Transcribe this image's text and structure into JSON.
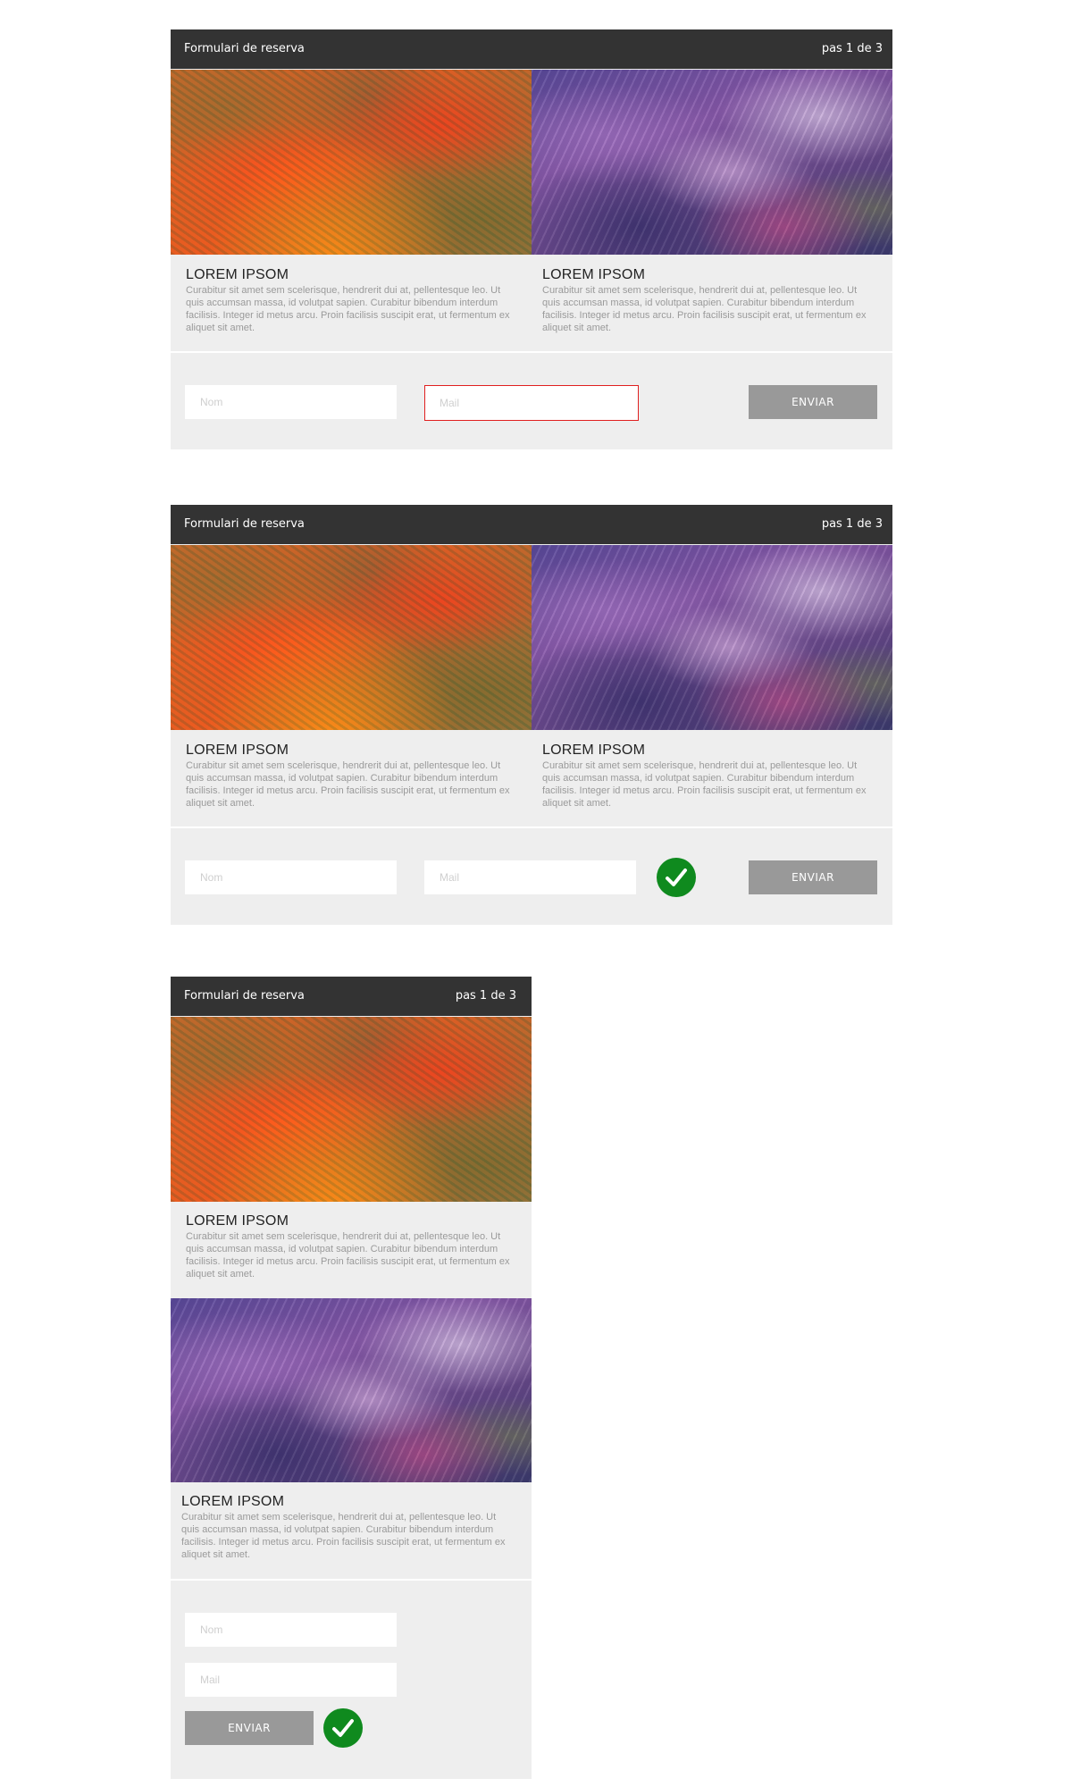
{
  "header": {
    "title": "Formulari de reserva",
    "step": "pas 1 de 3"
  },
  "card1": {
    "title": "LOREM IPSOM",
    "text": "Curabitur sit amet sem scelerisque, hendrerit dui at, pellentesque leo. Ut quis accumsan massa, id volutpat sapien. Curabitur bibendum interdum facilisis. Integer id metus arcu. Proin facilisis suscipit erat, ut fermentum ex aliquet sit amet."
  },
  "card2": {
    "title": "LOREM IPSOM",
    "text": "Curabitur sit amet sem scelerisque, hendrerit dui at, pellentesque leo. Ut quis accumsan massa, id volutpat sapien. Curabitur bibendum interdum facilisis. Integer id metus arcu. Proin facilisis suscipit erat, ut fermentum ex aliquet sit amet."
  },
  "form": {
    "name_placeholder": "Nom",
    "mail_placeholder": "Mail",
    "submit_label": "ENVIAR"
  },
  "colors": {
    "header_bg": "#333333",
    "panel_bg": "#eeeeee",
    "error_border": "#e02020",
    "success": "#0f8a1e",
    "button_bg": "#999999"
  },
  "icons": {
    "success": "checkmark-icon"
  }
}
